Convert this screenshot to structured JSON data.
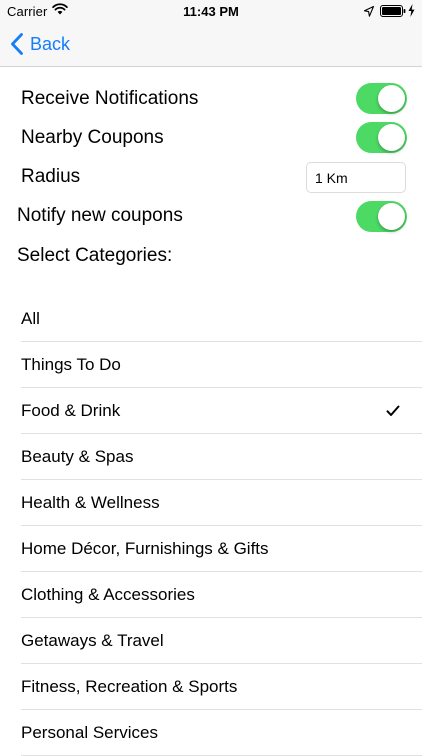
{
  "status_bar": {
    "carrier": "Carrier",
    "time": "11:43 PM"
  },
  "nav": {
    "back_label": "Back"
  },
  "settings": {
    "receive_notifications": {
      "label": "Receive Notifications",
      "on": true
    },
    "nearby_coupons": {
      "label": "Nearby Coupons",
      "on": true
    },
    "radius": {
      "label": "Radius",
      "value": "1 Km"
    },
    "notify_new_coupons": {
      "label": "Notify new coupons",
      "on": true
    },
    "select_categories_label": "Select Categories:"
  },
  "categories": [
    {
      "label": "All",
      "checked": false
    },
    {
      "label": "Things To Do",
      "checked": false
    },
    {
      "label": "Food & Drink",
      "checked": true
    },
    {
      "label": "Beauty & Spas",
      "checked": false
    },
    {
      "label": "Health & Wellness",
      "checked": false
    },
    {
      "label": "Home Décor, Furnishings & Gifts",
      "checked": false
    },
    {
      "label": "Clothing & Accessories",
      "checked": false
    },
    {
      "label": "Getaways & Travel",
      "checked": false
    },
    {
      "label": "Fitness, Recreation & Sports",
      "checked": false
    },
    {
      "label": "Personal Services",
      "checked": false
    }
  ],
  "colors": {
    "accent": "#147efb",
    "toggle_on": "#4cd964"
  }
}
